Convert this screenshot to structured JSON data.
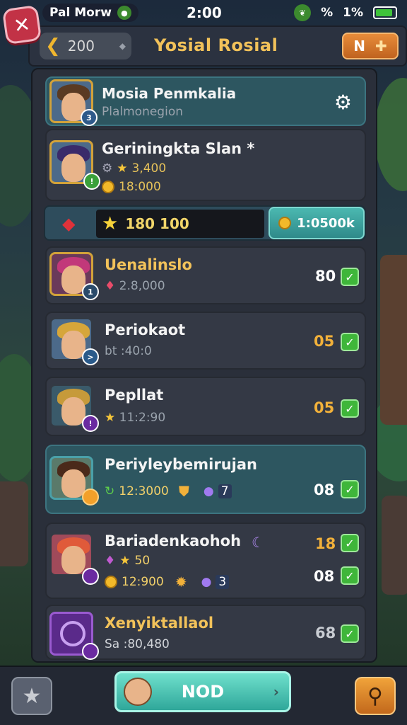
{
  "status": {
    "carrier": "Pal Morw",
    "time": "2:00",
    "percent_symbol": "%",
    "battery": "1%",
    "battery_level": 0.9
  },
  "header": {
    "back_value": "200",
    "title": "Yosial Rosial",
    "right_button_label": "N"
  },
  "profile": {
    "name": "Mosia Penmkalia",
    "subtitle": "Plalmonegion",
    "level_badge": "3"
  },
  "player": {
    "name": "Geriningkta Slan *",
    "stat1": "3,400",
    "stat2": "18:000",
    "badge": "!"
  },
  "resources": {
    "stars": "180 100",
    "coins": "1:0500k"
  },
  "list": [
    {
      "name": "Uenalinslo",
      "sub": "2.8,000",
      "score": "80",
      "badge": "1"
    },
    {
      "name": "Periokaot",
      "sub": "bt :40:0",
      "score": "05",
      "badge": ">"
    },
    {
      "name": "Pepllat",
      "sub": "11:2:90",
      "score": "05",
      "badge": "!"
    },
    {
      "name": "Periyleybemirujan",
      "sub": "12:3000",
      "score": "08",
      "level": "7"
    },
    {
      "name": "Bariadenkaohoh",
      "sub": "50",
      "sub2": "12:900",
      "score": "18",
      "score2": "08",
      "level": "3"
    },
    {
      "name": "Xenyiktallaol",
      "sub": "Sa :80,480",
      "score": "68"
    }
  ],
  "footer": {
    "main_button_label": "NOD"
  },
  "colors": {
    "accent_gold": "#f2c25a",
    "check_green": "#3fb63a",
    "teal": "#2fa79a"
  }
}
